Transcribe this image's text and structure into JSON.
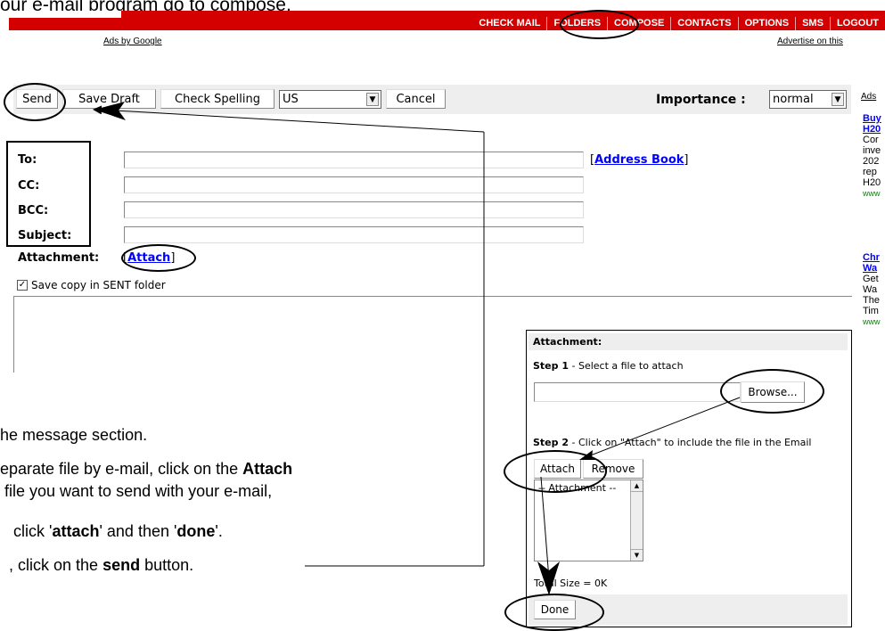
{
  "page": {
    "top_instruction": "our e-mail program go to compose."
  },
  "nav": {
    "items": [
      "CHECK MAIL",
      "FOLDERS",
      "COMPOSE",
      "CONTACTS",
      "OPTIONS",
      "SMS",
      "LOGOUT"
    ]
  },
  "ads": {
    "ads_by_google": "Ads by Google",
    "advertise": "Advertise on this",
    "right_header": "Ads",
    "ad1": {
      "title1": "Buy",
      "title2": "H20",
      "lines": [
        "Cor",
        "inve",
        "202",
        "rep",
        "H20"
      ],
      "url": "www"
    },
    "ad2": {
      "title1": "Chr",
      "title2": "Wa",
      "lines": [
        "Get",
        "Wa",
        "The",
        "Tim"
      ],
      "url": "www"
    }
  },
  "toolbar": {
    "send": "Send",
    "save_draft": "Save Draft",
    "check_spelling": "Check Spelling",
    "language": "US",
    "cancel": "Cancel",
    "importance_label": "Importance :",
    "importance_value": "normal"
  },
  "form": {
    "to_label": "To:",
    "cc_label": "CC:",
    "bcc_label": "BCC:",
    "subject_label": "Subject:",
    "address_book_open": "[",
    "address_book": "Address Book",
    "address_book_close": "]",
    "attachment_label": "Attachment:",
    "attach_open": "[",
    "attach": "Attach",
    "attach_close": "]",
    "save_copy": "Save copy in SENT folder",
    "save_copy_checked": true
  },
  "instructions": {
    "line1": "he message section.",
    "line2_pre": "eparate file by e-mail, click on the ",
    "line2_bold": "Attach",
    "line3": " file you want to send with your e-mail,",
    "line4_pre": " click '",
    "line4_bold1": "attach",
    "line4_mid": "' and then '",
    "line4_bold2": "done",
    "line4_post": "'.",
    "line5_pre": ", click on the ",
    "line5_bold": "send",
    "line5_post": " button."
  },
  "attachment_popup": {
    "title": "Attachment:",
    "step1_label": "Step 1",
    "step1_text": " - Select a file to attach",
    "browse": "Browse...",
    "step2_label": "Step 2",
    "step2_text": " - Click on \"Attach\" to include the file in the Email",
    "attach": "Attach",
    "remove": "Remove",
    "list_item": "-- Attachment --",
    "total_size": "Total Size = 0K",
    "done": "Done"
  }
}
